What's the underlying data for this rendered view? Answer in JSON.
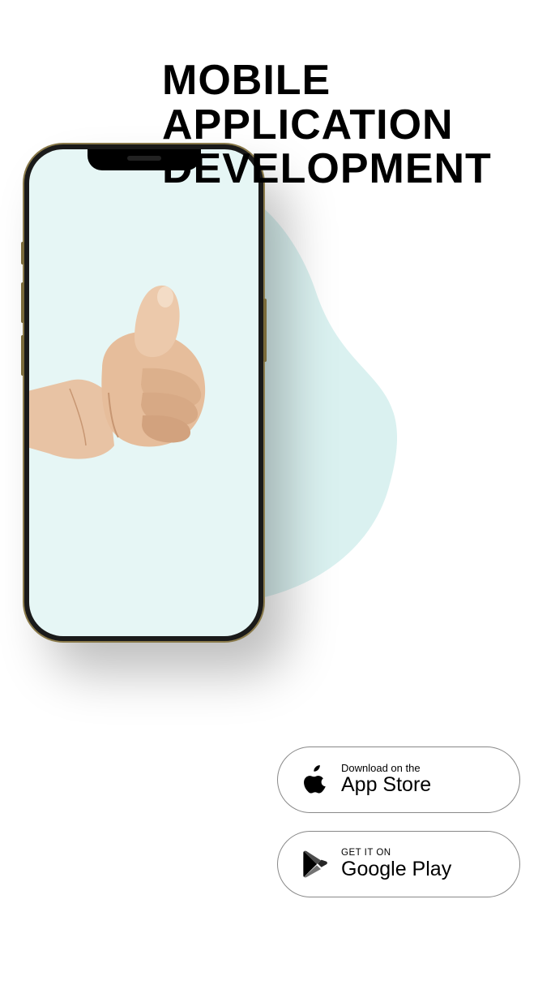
{
  "heading": {
    "line1": "MOBILE",
    "line2": "APPLICATION",
    "line3": "DEVELOPMENT"
  },
  "phone": {
    "gesture_name": "thumbs-up"
  },
  "store": {
    "apple": {
      "small": "Download on the",
      "big": "App Store"
    },
    "google": {
      "small": "GET IT ON",
      "big": "Google Play"
    }
  },
  "colors": {
    "blob": "#daf1f0",
    "phone_frame": "#8a7a4a",
    "screen_bg": "#e6f6f5"
  }
}
